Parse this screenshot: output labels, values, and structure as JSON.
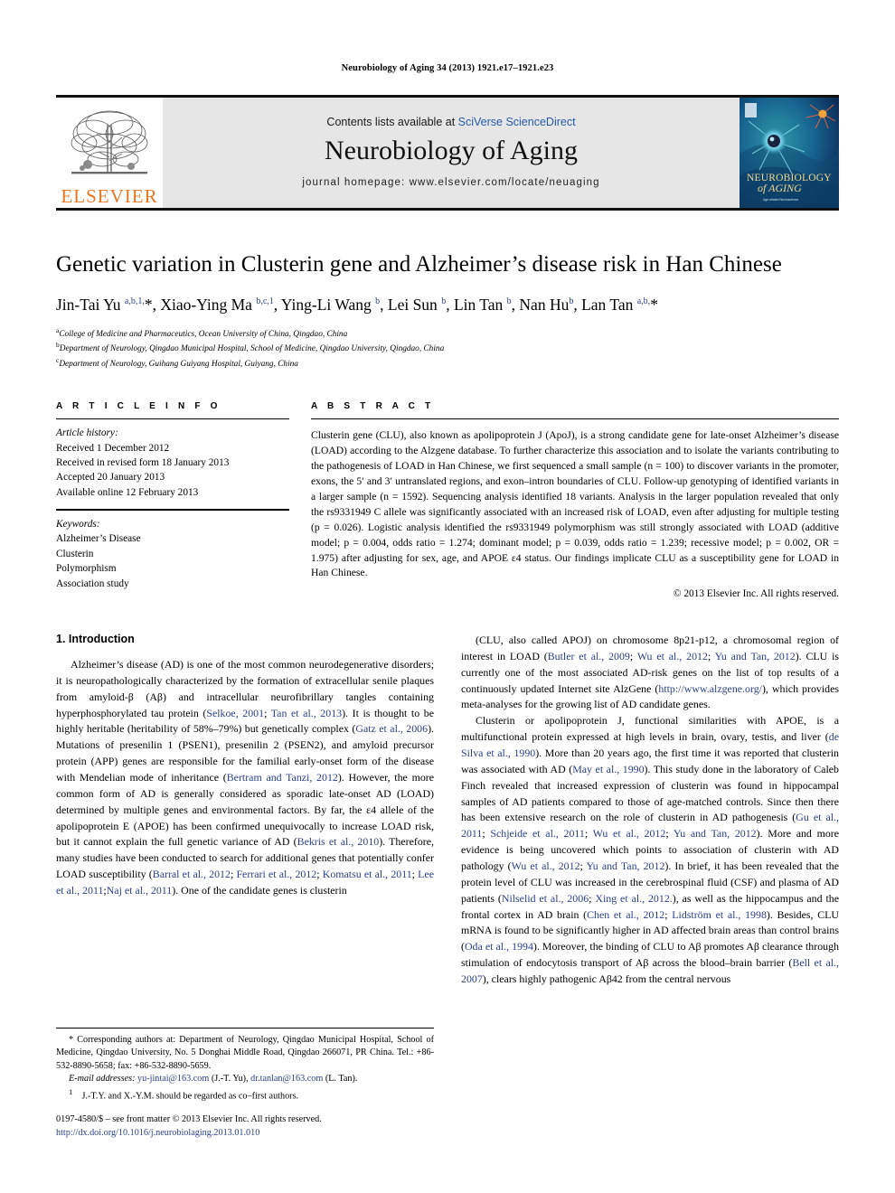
{
  "running_head": "Neurobiology of Aging 34 (2013) 1921.e17–1921.e23",
  "masthead": {
    "publisher_name": "ELSEVIER",
    "publisher_logo_name": "elsevier-tree-logo",
    "contents_prefix": "Contents lists available at ",
    "contents_link": "SciVerse ScienceDirect",
    "journal_title": "Neurobiology of Aging",
    "homepage_label": "journal homepage: www.elsevier.com/locate/neuaging",
    "cover_title_line1": "NEUROBIOLOGY",
    "cover_title_line2": "of AGING",
    "link_color": "#2b59a8",
    "band_color": "#e6e6e6",
    "brand_orange": "#E87722"
  },
  "article": {
    "title": "Genetic variation in Clusterin gene and Alzheimer’s disease risk in Han Chinese",
    "authors_html": "Jin-Tai Yu <sup>a,b,1,</sup>*, Xiao-Ying Ma <sup>b,c,1</sup>, Ying-Li Wang <sup>b</sup>, Lei Sun <sup>b</sup>, Lin Tan <sup>b</sup>, Nan Hu<sup>b</sup>, Lan Tan <sup>a,b,</sup>*",
    "affiliations": [
      {
        "marker": "a",
        "text": "College of Medicine and Pharmaceutics, Ocean University of China, Qingdao, China"
      },
      {
        "marker": "b",
        "text": "Department of Neurology, Qingdao Municipal Hospital, School of Medicine, Qingdao University, Qingdao, China"
      },
      {
        "marker": "c",
        "text": "Department of Neurology, Guihang Guiyang Hospital, Guiyang, China"
      }
    ]
  },
  "article_info": {
    "heading": "A R T I C L E   I N F O",
    "history_label": "Article history:",
    "history": [
      "Received 1 December 2012",
      "Received in revised form 18 January 2013",
      "Accepted 20 January 2013",
      "Available online 12 February 2013"
    ],
    "keywords_label": "Keywords:",
    "keywords": [
      "Alzheimer’s Disease",
      "Clusterin",
      "Polymorphism",
      "Association study"
    ]
  },
  "abstract": {
    "heading": "A B S T R A C T",
    "text": "Clusterin gene (CLU), also known as apolipoprotein J (ApoJ), is a strong candidate gene for late-onset Alzheimer’s disease (LOAD) according to the Alzgene database. To further characterize this association and to isolate the variants contributing to the pathogenesis of LOAD in Han Chinese, we first sequenced a small sample (n = 100) to discover variants in the promoter, exons, the 5′ and 3′ untranslated regions, and exon–intron boundaries of CLU. Follow-up genotyping of identified variants in a larger sample (n = 1592). Sequencing analysis identified 18 variants. Analysis in the larger population revealed that only the rs9331949 C allele was significantly associated with an increased risk of LOAD, even after adjusting for multiple testing (p = 0.026). Logistic analysis identified the rs9331949 polymorphism was still strongly associated with LOAD (additive model; p = 0.004, odds ratio = 1.274; dominant model; p = 0.039, odds ratio = 1.239; recessive model; p = 0.002, OR = 1.975) after adjusting for sex, age, and APOE ε4 status. Our findings implicate CLU as a susceptibility gene for LOAD in Han Chinese.",
    "copyright": "© 2013 Elsevier Inc. All rights reserved."
  },
  "body": {
    "section_number_title": "1. Introduction",
    "left_paragraph_1_html": "Alzheimer’s disease (AD) is one of the most common neurodegenerative disorders; it is neuropathologically characterized by the formation of extracellular senile plaques from amyloid-β (Aβ) and intracellular neurofibrillary tangles containing hyperphosphorylated tau protein (<span class=\"ref\">Selkoe, 2001</span>; <span class=\"ref\">Tan et al., 2013</span>). It is thought to be highly heritable (heritability of 58%–79%) but genetically complex (<span class=\"ref\">Gatz et al., 2006</span>). Mutations of presenilin 1 (PSEN1), presenilin 2 (PSEN2), and amyloid precursor protein (APP) genes are responsible for the familial early-onset form of the disease with Mendelian mode of inheritance (<span class=\"ref\">Bertram and Tanzi, 2012</span>). However, the more common form of AD is generally considered as sporadic late-onset AD (LOAD) determined by multiple genes and environmental factors. By far, the ε4 allele of the apolipoprotein E (APOE) has been confirmed unequivocally to increase LOAD risk, but it cannot explain the full genetic variance of AD (<span class=\"ref\">Bekris et al., 2010</span>). Therefore, many studies have been conducted to search for additional genes that potentially confer LOAD susceptibility (<span class=\"ref\">Barral et al., 2012</span>; <span class=\"ref\">Ferrari et al., 2012</span>; <span class=\"ref\">Komatsu et al., 2011</span>; <span class=\"ref\">Lee et al., 2011</span>;<span class=\"ref\">Naj et al., 2011</span>). One of the candidate genes is clusterin",
    "right_paragraph_1_html": "(CLU, also called APOJ) on chromosome 8p21-p12, a chromosomal region of interest in LOAD (<span class=\"ref\">Butler et al., 2009</span>; <span class=\"ref\">Wu et al., 2012</span>; <span class=\"ref\">Yu and Tan, 2012</span>). CLU is currently one of the most associated AD-risk genes on the list of top results of a continuously updated Internet site AlzGene (<span class=\"url\">http://www.alzgene.org/</span>), which provides meta-analyses for the growing list of AD candidate genes.",
    "right_paragraph_2_html": "Clusterin or apolipoprotein J, functional similarities with APOE, is a multifunctional protein expressed at high levels in brain, ovary, testis, and liver (<span class=\"ref\">de Silva et al., 1990</span>). More than 20 years ago, the first time it was reported that clusterin was associated with AD (<span class=\"ref\">May et al., 1990</span>). This study done in the laboratory of Caleb Finch revealed that increased expression of clusterin was found in hippocampal samples of AD patients compared to those of age-matched controls. Since then there has been extensive research on the role of clusterin in AD pathogenesis (<span class=\"ref\">Gu et al., 2011</span>; <span class=\"ref\">Schjeide et al., 2011</span>; <span class=\"ref\">Wu et al., 2012</span>; <span class=\"ref\">Yu and Tan, 2012</span>). More and more evidence is being uncovered which points to association of clusterin with AD pathology (<span class=\"ref\">Wu et al., 2012</span>; <span class=\"ref\">Yu and Tan, 2012</span>). In brief, it has been revealed that the protein level of CLU was increased in the cerebrospinal fluid (CSF) and plasma of AD patients (<span class=\"ref\">Nilselid et al., 2006</span>; <span class=\"ref\">Xing et al., 2012.</span>), as well as the hippocampus and the frontal cortex in AD brain (<span class=\"ref\">Chen et al., 2012</span>; <span class=\"ref\">Lidström et al., 1998</span>). Besides, CLU mRNA is found to be significantly higher in AD affected brain areas than control brains (<span class=\"ref\">Oda et al., 1994</span>). Moreover, the binding of CLU to Aβ promotes Aβ clearance through stimulation of endocytosis transport of Aβ across the blood–brain barrier (<span class=\"ref\">Bell et al., 2007</span>), clears highly pathogenic Aβ42 from the central nervous"
  },
  "footnotes": {
    "corresponding_html": "* Corresponding authors at: Department of Neurology, Qingdao Municipal Hospital, School of Medicine, Qingdao University, No. 5 Donghai Middle Road, Qingdao 266071, PR China. Tel.: +86-532-8890-5658; fax: +86-532-8890-5659.",
    "email_html": "<em>E-mail addresses:</em> <span class=\"url\">yu-jintai@163.com</span> (J.-T. Yu), <span class=\"url\">dr.tanlan@163.com</span> (L. Tan).",
    "cofirst_html": "<sup>1</sup> J.-T.Y. and X.-Y.M. should be regarded as co–first authors.",
    "issn_line": "0197-4580/$ – see front matter © 2013 Elsevier Inc. All rights reserved.",
    "doi_line": "http://dx.doi.org/10.1016/j.neurobiolaging.2013.01.010"
  }
}
